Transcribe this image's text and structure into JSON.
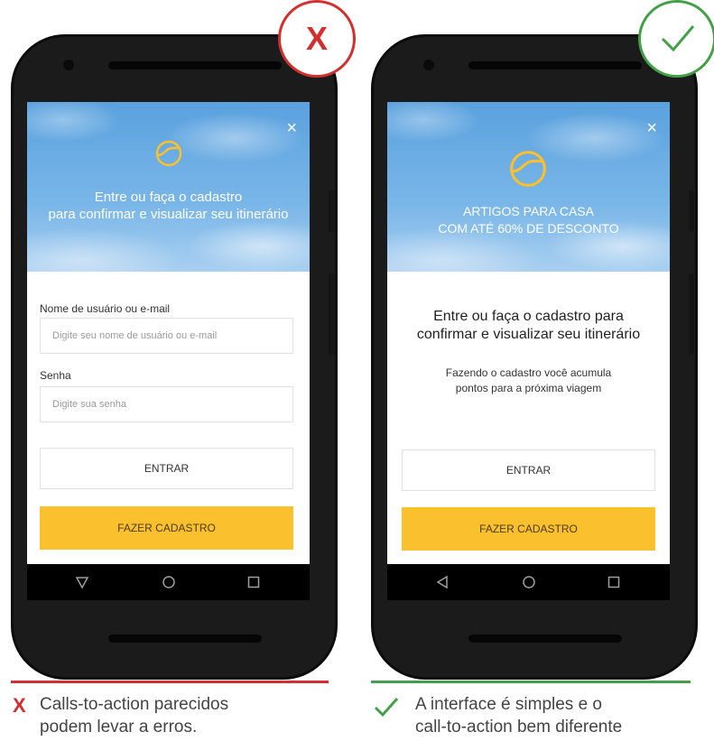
{
  "left": {
    "hero_line1": "Entre ou faça o cadastro",
    "hero_line2": "para confirmar e visualizar seu itinerário",
    "username_label": "Nome de usuário ou e-mail",
    "username_placeholder": "Digite seu nome de usuário ou e-mail",
    "password_label": "Senha",
    "password_placeholder": "Digite sua senha",
    "login_button": "ENTRAR",
    "signup_button": "FAZER CADASTRO",
    "close_glyph": "×"
  },
  "right": {
    "hero_line1": "ARTIGOS PARA CASA",
    "hero_line2": "COM ATÉ 60% DE DESCONTO",
    "title_line1": "Entre ou faça o cadastro para",
    "title_line2": "confirmar e visualizar seu itinerário",
    "subtitle_line1": "Fazendo o cadastro você acumula",
    "subtitle_line2": "pontos para a próxima viagem",
    "login_button": "ENTRAR",
    "signup_button": "FAZER CADASTRO",
    "close_glyph": "×"
  },
  "badges": {
    "wrong_symbol": "X",
    "right_symbol": "✓"
  },
  "captions": {
    "wrong_line1": "Calls-to-action parecidos",
    "wrong_line2": "podem levar a erros.",
    "right_line1": "A interface é simples e o",
    "right_line2": "call-to-action bem diferente"
  },
  "colors": {
    "accent_yellow": "#fbc02d",
    "wrong_red": "#d32f2f",
    "right_green": "#43a047",
    "sky_blue": "#5aa1de"
  },
  "icons": {
    "logo": "slashed-circle-icon",
    "close": "close-icon",
    "nav_back": "back-triangle-icon",
    "nav_home": "home-circle-icon",
    "nav_recent": "recent-square-icon"
  }
}
